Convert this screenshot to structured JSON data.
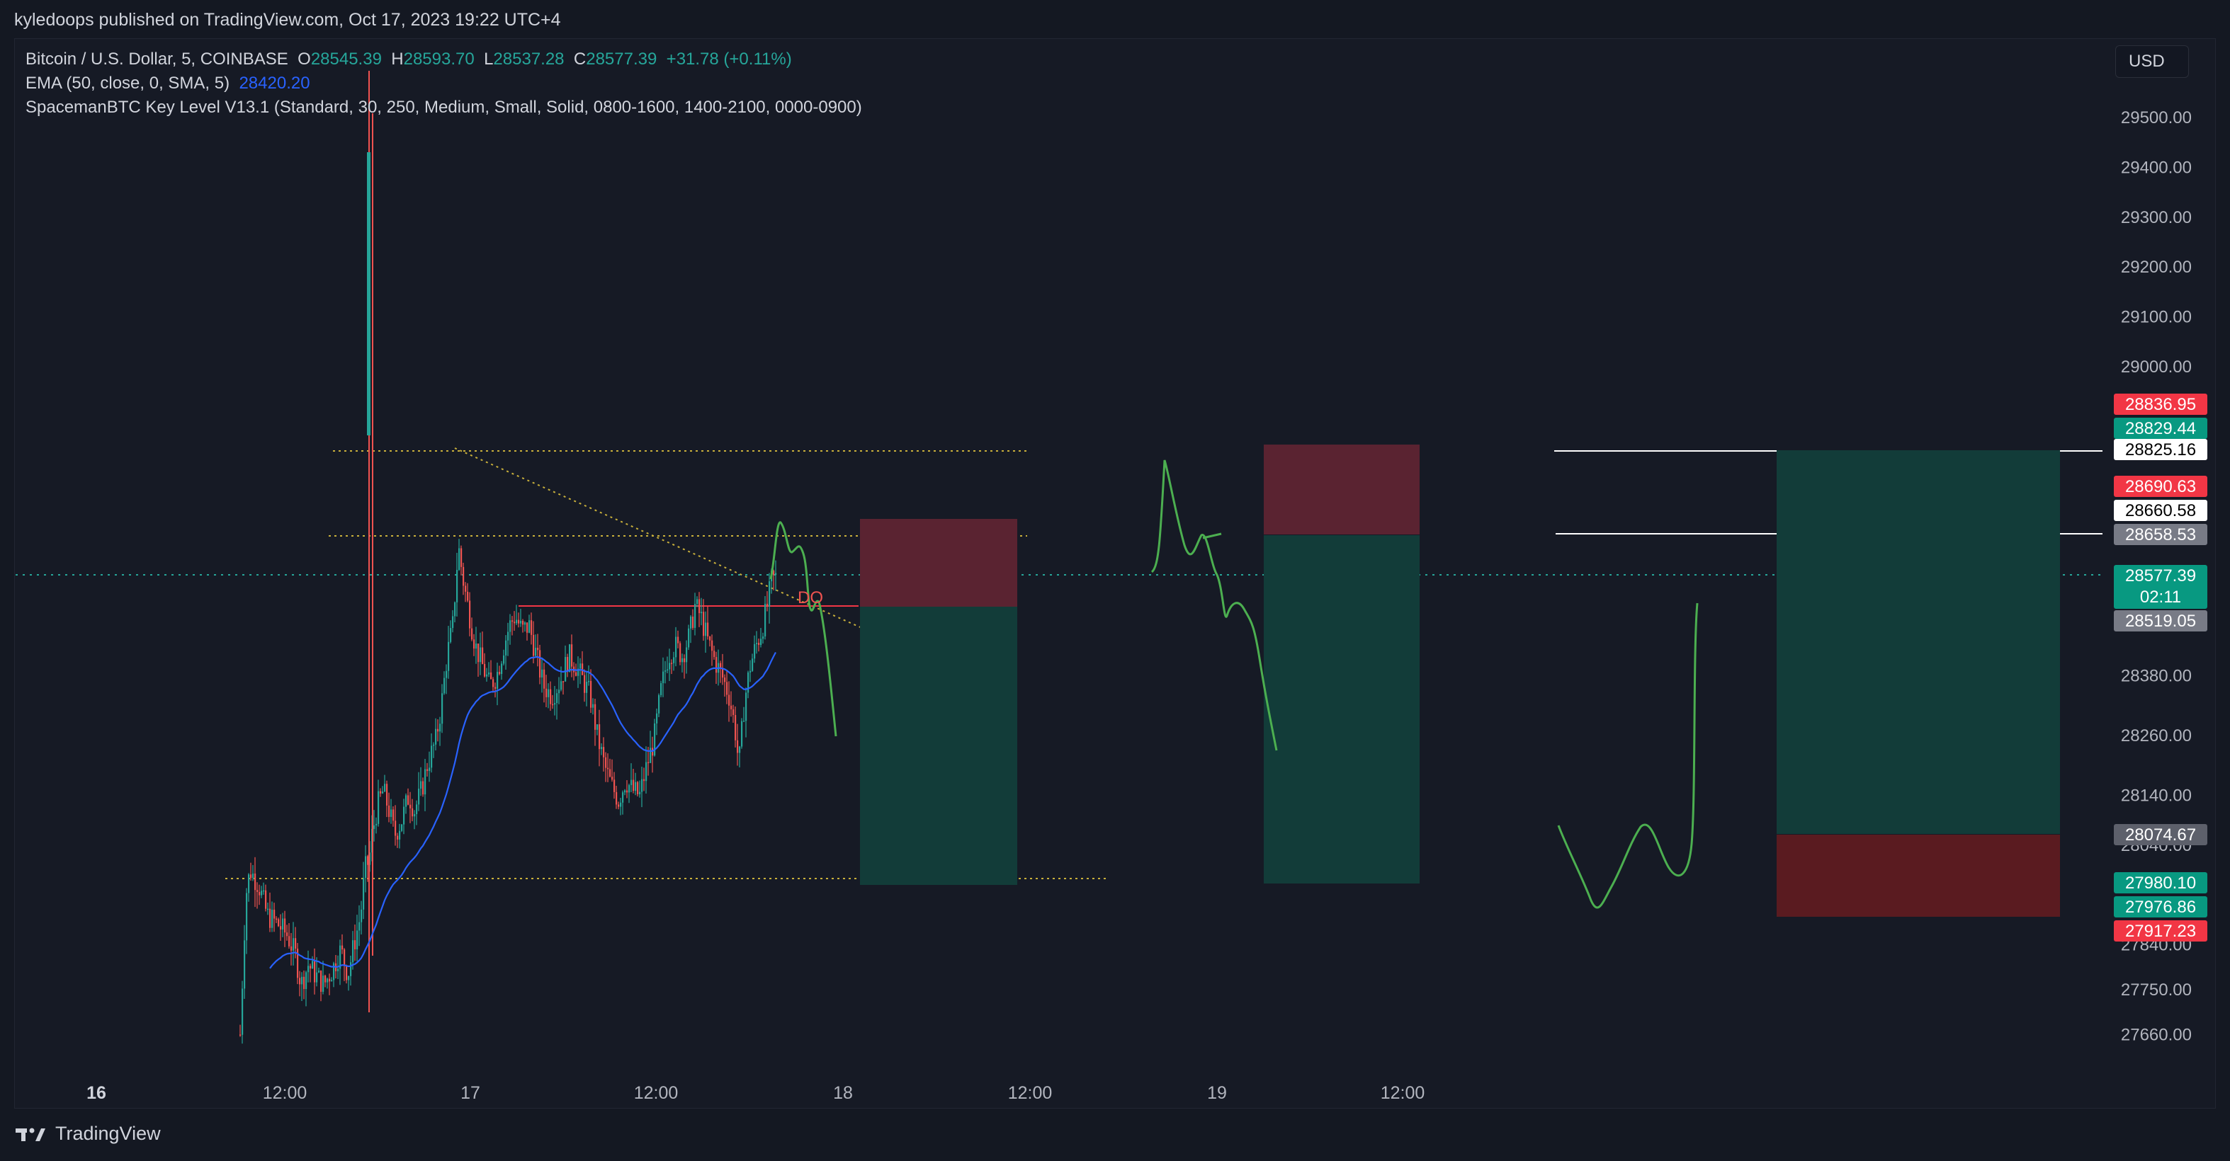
{
  "header": {
    "publisher": "kyledoops published on TradingView.com, Oct 17, 2023 19:22 UTC+4"
  },
  "legend": {
    "symbol": "Bitcoin / U.S. Dollar, 5, COINBASE",
    "o_label": "O",
    "o_value": "28545.39",
    "h_label": "H",
    "h_value": "28593.70",
    "l_label": "L",
    "l_value": "28537.28",
    "c_label": "C",
    "c_value": "28577.39",
    "change": "+31.78 (+0.11%)",
    "ema_label": "EMA (50, close, 0, SMA, 5)",
    "ema_value": "28420.20",
    "indicator": "SpacemanBTC Key Level V13.1 (Standard, 30, 250, Medium, Small, Solid, 0800-1600, 1400-2100, 0000-0900)"
  },
  "currency_button": "USD",
  "footer": {
    "brand": "TradingView"
  },
  "annotation_text": "DO",
  "colors": {
    "background": "#161a25",
    "up": "#26a69a",
    "down": "#ef5350",
    "ema": "#2962ff",
    "drawing": "#4caf50",
    "level": "#c9b03b",
    "profit_zone": "#123c39",
    "loss_zone": "#5a2331"
  },
  "chart_data": {
    "type": "candlestick",
    "timeframe": "5",
    "x_ticks": [
      "16",
      "12:00",
      "17",
      "12:00",
      "18",
      "12:00",
      "19",
      "12:00"
    ],
    "y_ticks": [
      29500,
      29400,
      29300,
      29200,
      29100,
      29000,
      28380,
      28260,
      28140,
      28040,
      27840,
      27750,
      27660
    ],
    "ylim": [
      27600,
      29600
    ],
    "last_price": 28577.39,
    "countdown": "02:11",
    "price_labels": [
      {
        "value": "28836.95",
        "bg": "#f23645",
        "fg": "#ffffff"
      },
      {
        "value": "28829.44",
        "bg": "#089981",
        "fg": "#ffffff"
      },
      {
        "value": "28825.16",
        "bg": "#ffffff",
        "fg": "#000000"
      },
      {
        "value": "28690.63",
        "bg": "#f23645",
        "fg": "#ffffff"
      },
      {
        "value": "28660.58",
        "bg": "#ffffff",
        "fg": "#000000"
      },
      {
        "value": "28658.53",
        "bg": "#787b86",
        "fg": "#ffffff"
      },
      {
        "value": "28577.39",
        "bg": "#089981",
        "fg": "#ffffff"
      },
      {
        "value": "28519.05",
        "bg": "#787b86",
        "fg": "#ffffff"
      },
      {
        "value": "28074.67",
        "bg": "#5d606b",
        "fg": "#ffffff"
      },
      {
        "value": "27980.10",
        "bg": "#089981",
        "fg": "#ffffff"
      },
      {
        "value": "27976.86",
        "bg": "#089981",
        "fg": "#ffffff"
      },
      {
        "value": "27917.23",
        "bg": "#f23645",
        "fg": "#ffffff"
      }
    ],
    "key_levels": [
      28825,
      28658,
      27975
    ],
    "positions": [
      {
        "direction": "short",
        "stop": 28690,
        "entry": 28510,
        "target": 27975
      },
      {
        "direction": "short",
        "stop": 28836,
        "entry": 28658,
        "target": 27976
      },
      {
        "direction": "long",
        "target": 28829,
        "entry": 28074,
        "stop": 27917
      }
    ]
  }
}
